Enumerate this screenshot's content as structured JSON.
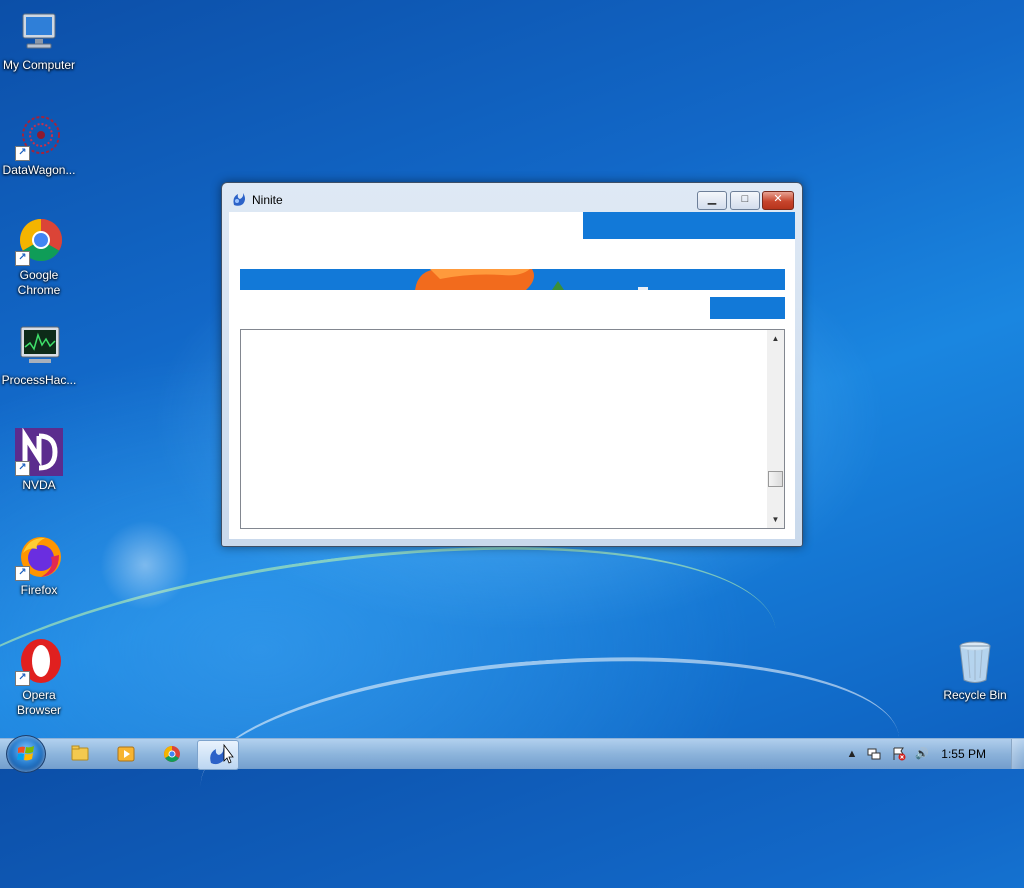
{
  "desktop": {
    "icons": [
      {
        "label": "My Computer"
      },
      {
        "label": "DataWagon..."
      },
      {
        "label": "Google Chrome"
      },
      {
        "label": "ProcessHac..."
      },
      {
        "label": "NVDA"
      },
      {
        "label": "Firefox"
      },
      {
        "label": "Opera Browser"
      },
      {
        "label": "Recycle Bin"
      }
    ]
  },
  "window": {
    "title": "Ninite",
    "minimize_glyph": "▁",
    "maximize_glyph": "□",
    "close_glyph": "✕",
    "scroll_up_glyph": "▲",
    "scroll_down_glyph": "▼",
    "accent": "#1279d8"
  },
  "taskbar": {
    "clock": "1:55 PM",
    "tray_glyphs": {
      "expand": "▲",
      "volume": "🔊"
    }
  },
  "icons": [
    "computer-icon",
    "datawagon-icon",
    "chrome-icon",
    "processhacker-icon",
    "nvda-icon",
    "firefox-icon",
    "opera-icon",
    "recycle-bin-icon",
    "windows-start-icon",
    "explorer-icon",
    "media-player-icon",
    "ninite-icon",
    "network-icon",
    "action-center-icon",
    "volume-icon"
  ]
}
